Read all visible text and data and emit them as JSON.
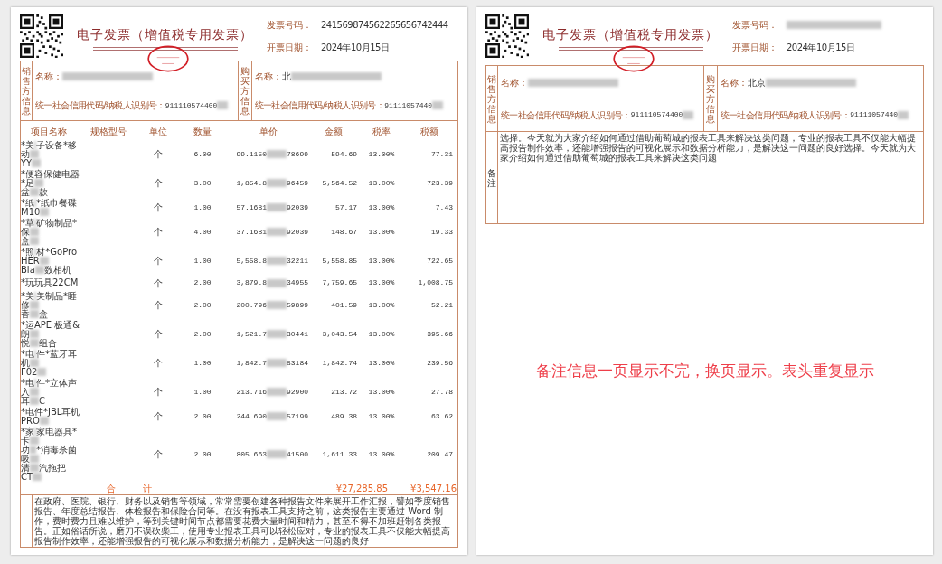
{
  "pages": [
    {
      "header": {
        "title": "电子发票（增值税专用发票）",
        "fields": [
          {
            "label": "发票号码：",
            "value": "241569874562265656742444"
          },
          {
            "label": "开票日期：",
            "value": "2024年10月15日"
          }
        ]
      },
      "parties": [
        {
          "side_label": "销售方信息",
          "name_label": "名称：",
          "id_label": "统一社会信用代码/纳税人识别号：",
          "id_value": "911110574400"
        },
        {
          "side_label": "购买方信息",
          "name_label": "名称：",
          "name_start": "北",
          "id_label": "统一社会信用代码/纳税人识别号：",
          "id_value": "91111057440"
        }
      ],
      "table": {
        "columns": [
          "项目名称",
          "规格型号",
          "单位",
          "数量",
          "单价",
          "金额",
          "税率",
          "税额"
        ],
        "rows": [
          {
            "name": [
              [
                "*美",
                "子设备*移"
              ],
              [
                "动"
              ],
              [
                "YY"
              ]
            ],
            "unit": "个",
            "qty": "6.00",
            "price": [
              "99.1150",
              "78699"
            ],
            "amount": "594.69",
            "rate": "13.00%",
            "tax": "77.31"
          },
          {
            "name": [
              [
                "*便",
                "容保健电器"
              ],
              [
                "*足"
              ],
              [
                "盆",
                "款"
              ]
            ],
            "unit": "个",
            "qty": "3.00",
            "price": [
              "1,854.8",
              "96459"
            ],
            "amount": "5,564.52",
            "rate": "13.00%",
            "tax": "723.39"
          },
          {
            "name": [
              [
                "*纸",
                "*纸巾餐碟"
              ],
              [
                "M10"
              ]
            ],
            "unit": "个",
            "qty": "1.00",
            "price": [
              "57.1681",
              "92039"
            ],
            "amount": "57.17",
            "rate": "13.00%",
            "tax": "7.43"
          },
          {
            "name": [
              [
                "*草",
                "矿物制品*"
              ],
              [
                "保"
              ],
              [
                "盒"
              ]
            ],
            "unit": "个",
            "qty": "4.00",
            "price": [
              "37.1681",
              "92039"
            ],
            "amount": "148.67",
            "rate": "13.00%",
            "tax": "19.33"
          },
          {
            "name": [
              [
                "*照",
                "材*GoPro"
              ],
              [
                "HER"
              ],
              [
                "Bla",
                "数相机"
              ]
            ],
            "unit": "个",
            "qty": "1.00",
            "price": [
              "5,558.8",
              "32211"
            ],
            "amount": "5,558.85",
            "rate": "13.00%",
            "tax": "722.65"
          },
          {
            "name": [
              [
                "*玩",
                "玩具22CM"
              ]
            ],
            "unit": "个",
            "qty": "2.00",
            "price": [
              "3,879.8",
              "34955"
            ],
            "amount": "7,759.65",
            "rate": "13.00%",
            "tax": "1,008.75"
          },
          {
            "name": [
              [
                "*美",
                "美制品*睡"
              ],
              [
                "修"
              ],
              [
                "香",
                "盒"
              ]
            ],
            "unit": "个",
            "qty": "2.00",
            "price": [
              "200.796",
              "59899"
            ],
            "amount": "401.59",
            "rate": "13.00%",
            "tax": "52.21"
          },
          {
            "name": [
              [
                "*运",
                "APE 极通&"
              ],
              [
                "朗"
              ],
              [
                "悦",
                "组合"
              ]
            ],
            "unit": "个",
            "qty": "2.00",
            "price": [
              "1,521.7",
              "30441"
            ],
            "amount": "3,043.54",
            "rate": "13.00%",
            "tax": "395.66"
          },
          {
            "name": [
              [
                "*电",
                "件*蓝牙耳"
              ],
              [
                "机"
              ],
              [
                "F02"
              ]
            ],
            "unit": "个",
            "qty": "1.00",
            "price": [
              "1,842.7",
              "83184"
            ],
            "amount": "1,842.74",
            "rate": "13.00%",
            "tax": "239.56"
          },
          {
            "name": [
              [
                "*电",
                "件*立体声"
              ],
              [
                "入"
              ],
              [
                "耳",
                "C"
              ]
            ],
            "unit": "个",
            "qty": "1.00",
            "price": [
              "213.716",
              "92900"
            ],
            "amount": "213.72",
            "rate": "13.00%",
            "tax": "27.78"
          },
          {
            "name": [
              [
                "*电",
                "件*JBL耳机"
              ],
              [
                "PRO"
              ]
            ],
            "unit": "个",
            "qty": "2.00",
            "price": [
              "244.690",
              "57199"
            ],
            "amount": "489.38",
            "rate": "13.00%",
            "tax": "63.62"
          },
          {
            "name": [
              [
                "*家",
                "家电器具*"
              ],
              [
                "卡"
              ],
              [
                "功",
                "*消毒杀菌"
              ],
              [
                "吸"
              ],
              [
                "清",
                "汽拖把"
              ],
              [
                "CT"
              ]
            ],
            "unit": "个",
            "qty": "2.00",
            "price": [
              "805.663",
              "41500"
            ],
            "amount": "1,611.33",
            "rate": "13.00%",
            "tax": "209.47"
          }
        ],
        "total": {
          "label": [
            "合",
            "计"
          ],
          "amount": "¥27,285.85",
          "tax": "¥3,547.16"
        }
      },
      "remarks": {
        "text": "在政府、医院、银行、财务以及销售等领域，常常需要创建各种报告文件来展开工作汇报，譬如季度销售报告、年度总结报告、体检报告和保险合同等。在没有报表工具支持之前，这类报告主要通过 Word 制作，费时费力且难以维护，等到关键时间节点都需要花费大量时间和精力，甚至不得不加班赶制各类报告。正如俗话所说，磨刀不误砍柴工，使用专业报表工具可以轻松应对，专业的报表工具不仅能大幅提高报告制作效率，还能增强报告的可视化展示和数据分析能力，是解决这一问题的良好"
      }
    },
    {
      "header": {
        "title": "电子发票（增值税专用发票）",
        "fields": [
          {
            "label": "发票号码："
          },
          {
            "label": "开票日期：",
            "value": "2024年10月15日"
          }
        ]
      },
      "parties": [
        {
          "side_label": "销售方信息",
          "name_label": "名称：",
          "id_label": "统一社会信用代码/纳税人识别号：",
          "id_value": "911110574400"
        },
        {
          "side_label": "购买方信息",
          "name_label": "名称：",
          "name_start": "北京",
          "id_label": "统一社会信用代码/纳税人识别号：",
          "id_value": "91111057440"
        }
      ],
      "remarks": {
        "label": "备注",
        "text": "选择。今天就为大家介绍如何通过借助葡萄城的报表工具来解决这类问题，专业的报表工具不仅能大幅提高报告制作效率，还能增强报告的可视化展示和数据分析能力，是解决这一问题的良好选择。今天就为大家介绍如何通过借助葡萄城的报表工具来解决这类问题"
      },
      "note": "备注信息一页显示不完，换页显示。表头重复显示"
    }
  ]
}
